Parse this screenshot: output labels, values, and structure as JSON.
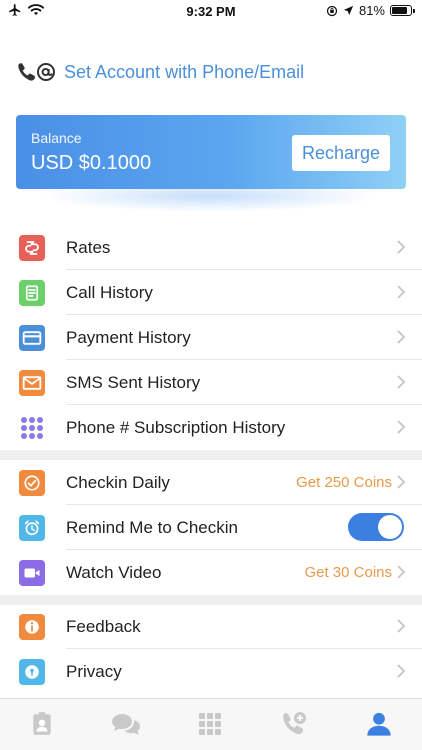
{
  "status_bar": {
    "time": "9:32 PM",
    "battery_text": "81%",
    "battery_level": 0.81,
    "icons": [
      "airplane-icon",
      "wifi-icon",
      "lock-rotation-icon",
      "location-arrow-icon",
      "battery-icon"
    ]
  },
  "account": {
    "icon": "phone-at-icon",
    "label": "Set Account with Phone/Email"
  },
  "balance": {
    "label": "Balance",
    "value": "USD $0.1000",
    "recharge_label": "Recharge"
  },
  "section1": [
    {
      "label": "Rates",
      "icon": "rates-icon",
      "color": "#e8605a"
    },
    {
      "label": "Call History",
      "icon": "call-history-icon",
      "color": "#6ccf6c"
    },
    {
      "label": "Payment History",
      "icon": "payment-history-icon",
      "color": "#4a90d9"
    },
    {
      "label": "SMS Sent History",
      "icon": "sms-icon",
      "color": "#f08a3c"
    },
    {
      "label": "Phone # Subscription History",
      "icon": "subscription-icon",
      "color": "#8c7ae6"
    }
  ],
  "section2": {
    "checkin": {
      "label": "Checkin Daily",
      "hint": "Get 250 Coins",
      "icon": "checkin-icon",
      "color": "#f08a3c"
    },
    "remind": {
      "label": "Remind Me to Checkin",
      "icon": "alarm-icon",
      "color": "#4fb8e8",
      "toggle_on": true
    },
    "video": {
      "label": "Watch Video",
      "hint": "Get 30 Coins",
      "icon": "video-icon",
      "color": "#8c6be6"
    }
  },
  "section3": [
    {
      "label": "Feedback",
      "icon": "feedback-icon",
      "color": "#f08a3c"
    },
    {
      "label": "Privacy",
      "icon": "privacy-icon",
      "color": "#4fb8e8"
    }
  ],
  "tabs": [
    {
      "icon": "contacts-icon",
      "active": false
    },
    {
      "icon": "messages-icon",
      "active": false
    },
    {
      "icon": "keypad-icon",
      "active": false
    },
    {
      "icon": "call-add-icon",
      "active": false
    },
    {
      "icon": "profile-icon",
      "active": true
    }
  ],
  "colors": {
    "accent": "#4a90d9",
    "coin_hint": "#e89a4a",
    "tab_inactive": "#c9c9c9",
    "tab_active": "#3b7fe0"
  }
}
